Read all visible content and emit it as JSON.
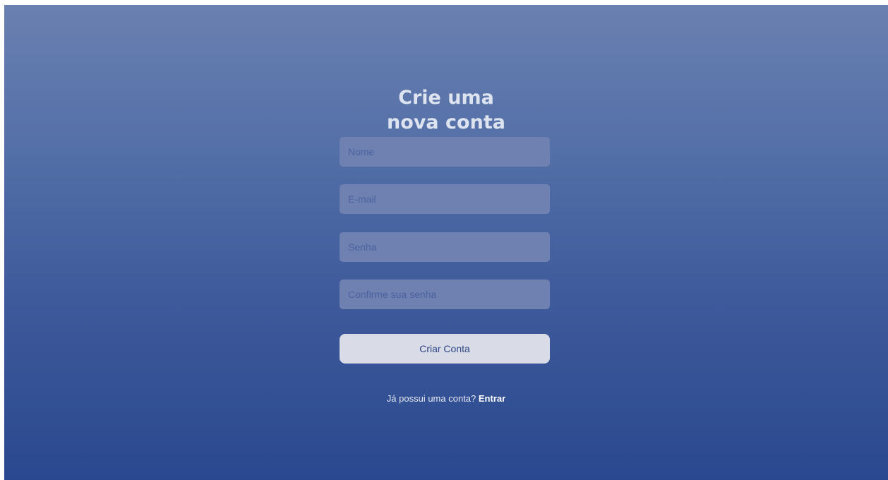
{
  "header": {
    "title_line1": "Crie uma",
    "title_line2": "nova conta"
  },
  "form": {
    "name_placeholder": "Nome",
    "email_placeholder": "E-mail",
    "password_placeholder": "Senha",
    "confirm_placeholder": "Confirme sua senha",
    "name_value": "",
    "email_value": "",
    "password_value": "",
    "confirm_value": "",
    "submit_label": "Criar Conta"
  },
  "footer": {
    "prompt": "Já possui uma conta?",
    "link_label": "Entrar"
  },
  "colors": {
    "gradient_top": "#6a80b0",
    "gradient_bottom": "#2a488f",
    "input_bg": "#6f81b1",
    "button_bg": "#d9dbe6",
    "button_text": "#2f4785"
  }
}
